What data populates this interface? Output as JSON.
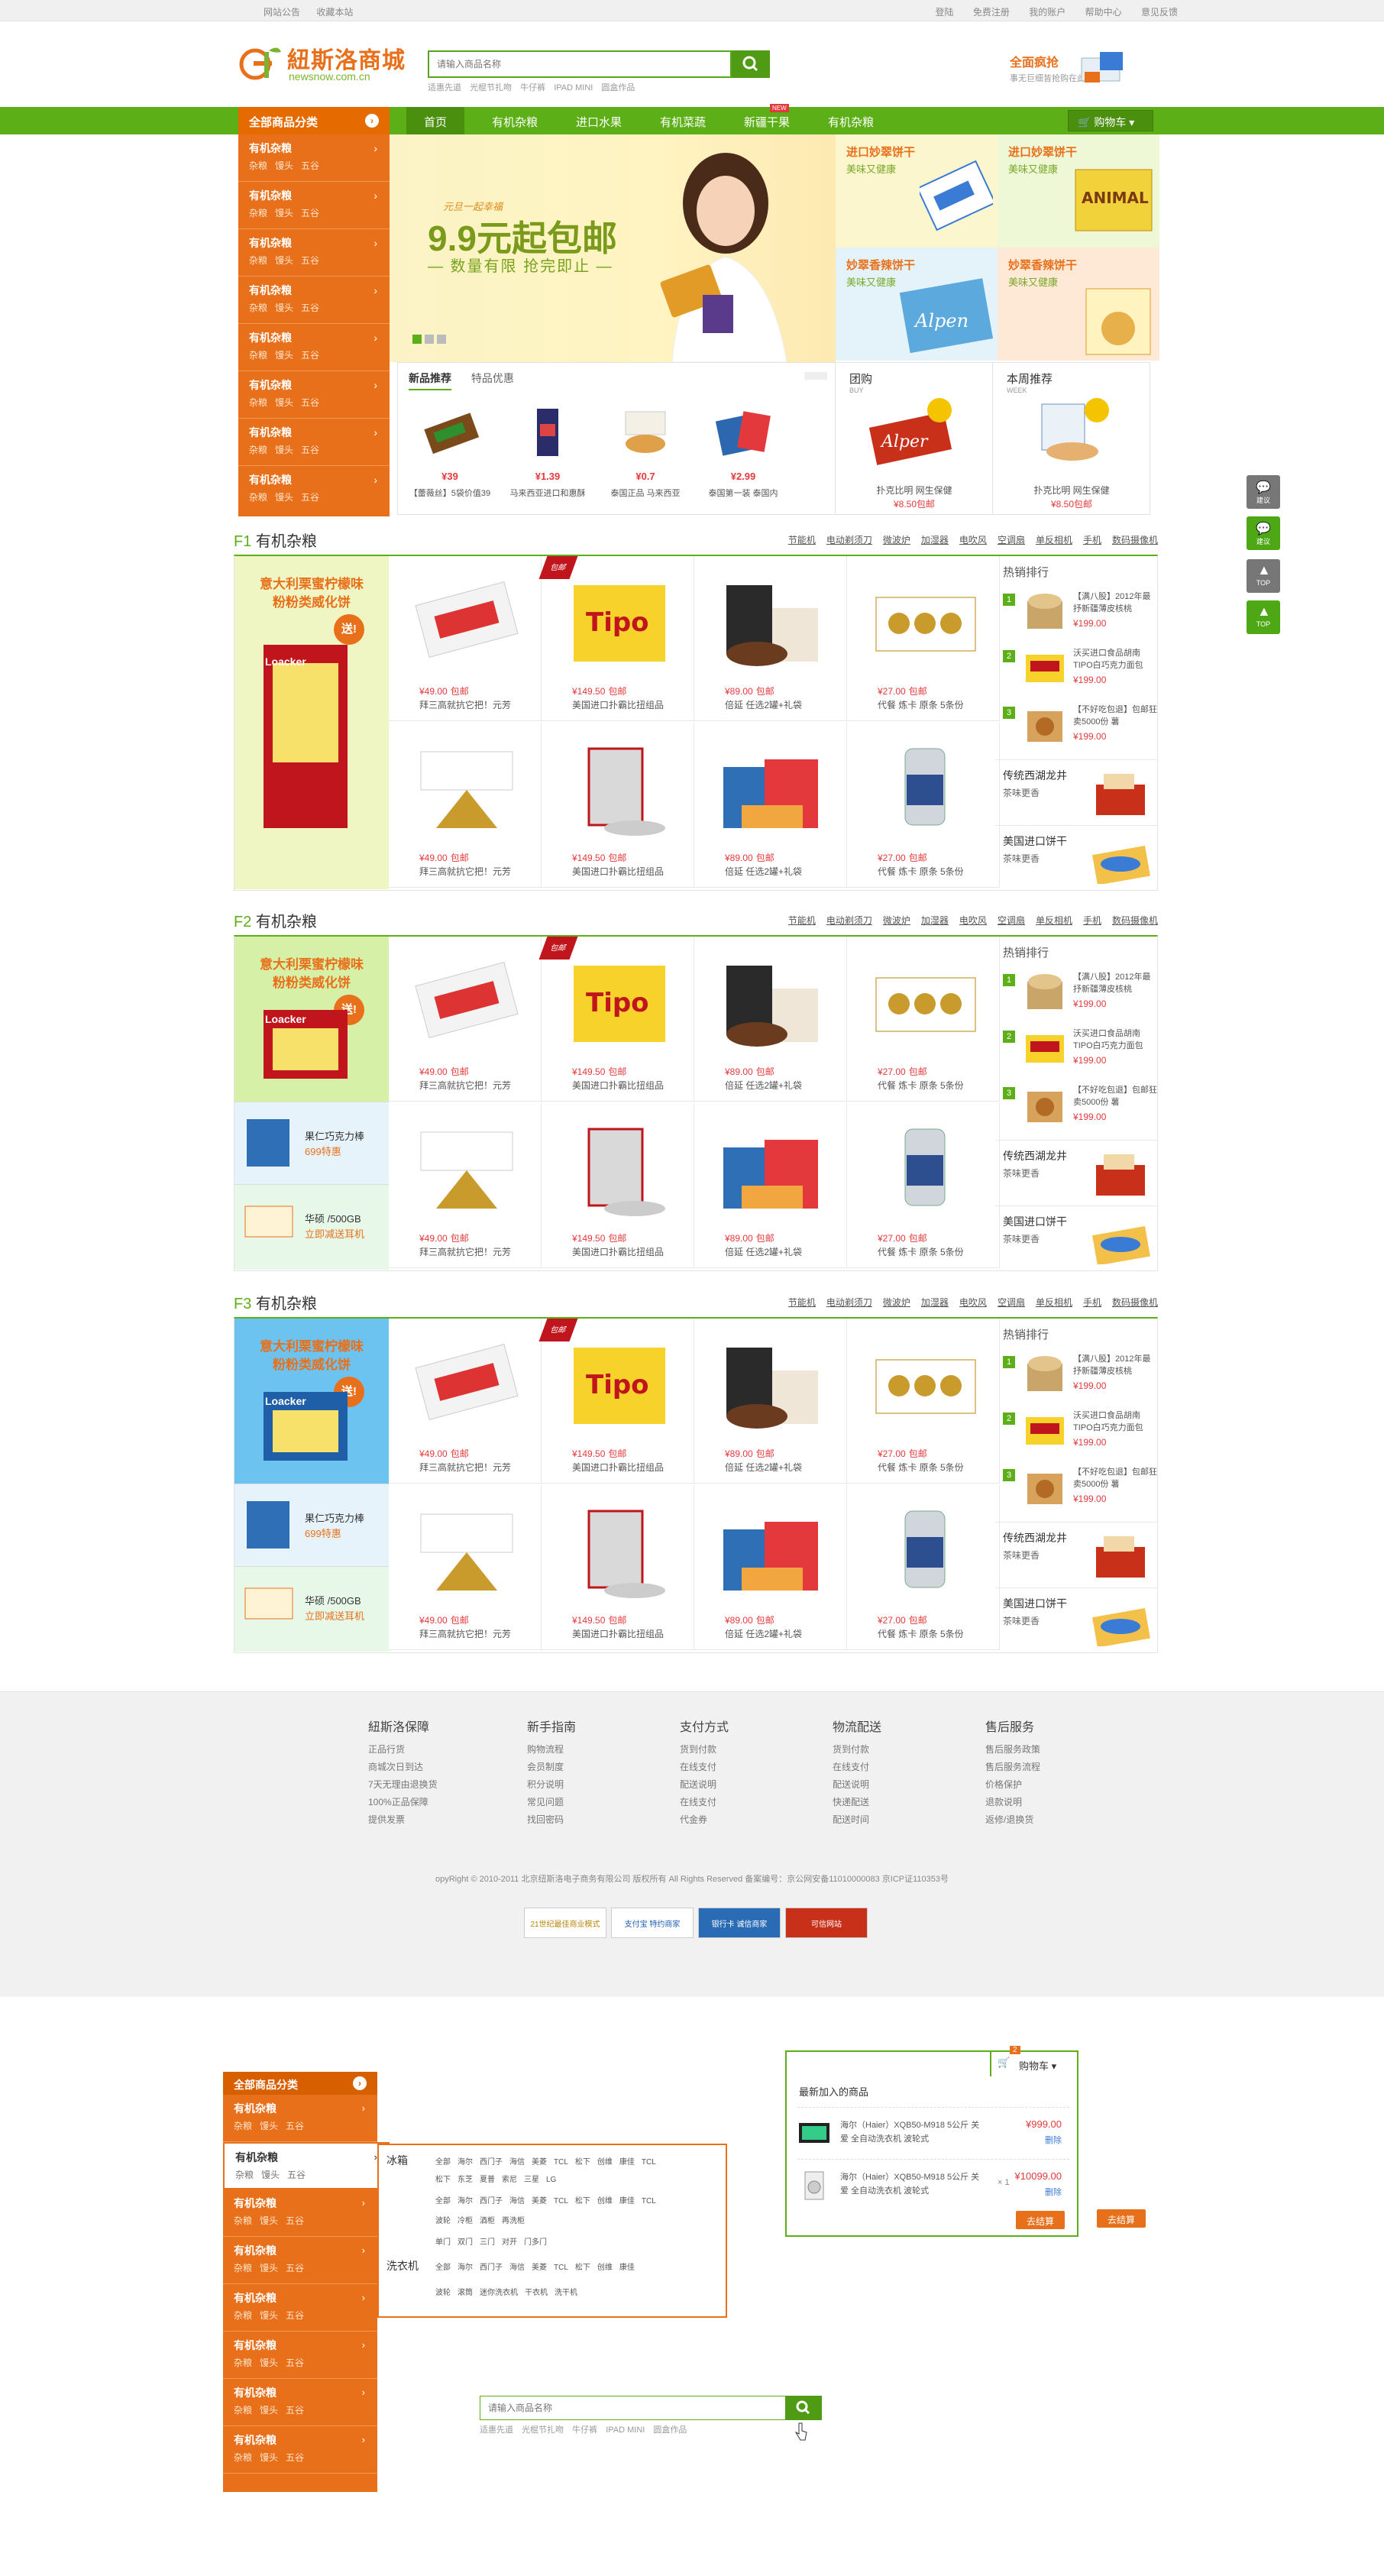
{
  "topbar": {
    "left": [
      "网站公告",
      "收藏本站"
    ],
    "right": [
      "登陆",
      "免费注册",
      "我的账户",
      "帮助中心",
      "意见反馈"
    ]
  },
  "logo": {
    "cn": "紐斯洛商城",
    "en": "newsnow.com.cn"
  },
  "search": {
    "placeholder": "请输入商品名称",
    "hot": [
      "适惠先道",
      "光棍节扎吻",
      "牛仔裤",
      "IPAD MINI",
      "圆盒作品"
    ]
  },
  "header_promo": {
    "title": "全面疯抢",
    "sub": "事无巨细皆抢购在此"
  },
  "nav": {
    "all_categories": "全部商品分类",
    "items": [
      "首页",
      "有机杂粮",
      "进口水果",
      "有机菜蔬",
      "新疆干果",
      "有机杂粮"
    ],
    "new_badge": "NEW",
    "cart": "购物车"
  },
  "categories": [
    {
      "title": "有机杂粮",
      "subs": [
        "杂粮",
        "馒头",
        "五谷"
      ]
    },
    {
      "title": "有机杂粮",
      "subs": [
        "杂粮",
        "馒头",
        "五谷"
      ]
    },
    {
      "title": "有机杂粮",
      "subs": [
        "杂粮",
        "馒头",
        "五谷"
      ]
    },
    {
      "title": "有机杂粮",
      "subs": [
        "杂粮",
        "馒头",
        "五谷"
      ]
    },
    {
      "title": "有机杂粮",
      "subs": [
        "杂粮",
        "馒头",
        "五谷"
      ]
    },
    {
      "title": "有机杂粮",
      "subs": [
        "杂粮",
        "馒头",
        "五谷"
      ]
    },
    {
      "title": "有机杂粮",
      "subs": [
        "杂粮",
        "馒头",
        "五谷"
      ]
    },
    {
      "title": "有机杂粮",
      "subs": [
        "杂粮",
        "馒头",
        "五谷"
      ]
    }
  ],
  "banner": {
    "small": "元旦一起幸福",
    "big": "9.9元起包邮",
    "sub": "— 数量有限 抢完即止 —"
  },
  "side_promos": [
    {
      "t1": "进口妙翠饼干",
      "t2": "美味又健康"
    },
    {
      "t1": "进口妙翠饼干",
      "t2": "美味又健康"
    },
    {
      "t1": "妙翠香辣饼干",
      "t2": "美味又健康"
    },
    {
      "t1": "妙翠香辣饼干",
      "t2": "美味又健康"
    }
  ],
  "new_tabs": [
    "新品推荐",
    "特品优惠"
  ],
  "new_products": [
    {
      "price": "¥39",
      "name": "【蕾薇丝】5袋价值39"
    },
    {
      "price": "¥1.39",
      "name": "马来西亚进口和惠酥"
    },
    {
      "price": "¥0.7",
      "name": "泰国正品 马来西亚"
    },
    {
      "price": "¥2.99",
      "name": "泰国第一装 泰国内"
    }
  ],
  "group_box": {
    "title": "团购",
    "title_en": "BUY",
    "name": "扑克比明 网生保健",
    "price": "¥8.50包邮"
  },
  "week_box": {
    "title": "本周推荐",
    "title_en": "WEEK",
    "name": "扑克比明 网生保健",
    "price": "¥8.50包邮"
  },
  "floor_links": [
    "节能机",
    "电动剃须刀",
    "微波炉",
    "加湿器",
    "电吹风",
    "空调扇",
    "单反相机",
    "手机",
    "数码摄像机"
  ],
  "floors": [
    {
      "num": "F1",
      "title": "有机杂粮"
    },
    {
      "num": "F2",
      "title": "有机杂粮"
    },
    {
      "num": "F3",
      "title": "有机杂粮"
    }
  ],
  "floor_ad": {
    "line1": "意大利栗蜜柠檬味",
    "line2": "粉粉类威化饼",
    "tag": "送!",
    "brand": "Loacker"
  },
  "floor_small_ads": [
    {
      "t1": "果仁巧克力棒",
      "t2": "699特惠"
    },
    {
      "t1": "华硕 /500GB",
      "t2": "立即减送耳机"
    }
  ],
  "floor_products": [
    {
      "price": "¥49.00",
      "tag": "包邮",
      "name": "拜三高就抗它把！元芳"
    },
    {
      "price": "¥149.50",
      "tag": "包邮",
      "name": "美国进口扑霸比扭组品"
    },
    {
      "price": "¥89.00",
      "tag": "包邮",
      "name": "倍延 任选2罐+礼袋"
    },
    {
      "price": "¥27.00",
      "tag": "包邮",
      "name": "代餐 炼卡 原条 5条份"
    },
    {
      "price": "¥49.00",
      "tag": "包邮",
      "name": "拜三高就抗它把！元芳"
    },
    {
      "price": "¥149.50",
      "tag": "包邮",
      "name": "美国进口扑霸比扭组品"
    },
    {
      "price": "¥89.00",
      "tag": "包邮",
      "name": "倍延 任选2罐+礼袋"
    },
    {
      "price": "¥27.00",
      "tag": "包邮",
      "name": "代餐 炼卡 原条 5条份"
    }
  ],
  "hot_badge": "包邮",
  "rank": {
    "title": "热销排行",
    "items": [
      {
        "n": "1",
        "text": "【满八股】2012年最抒新疆薄皮核桃",
        "price": "¥199.00"
      },
      {
        "n": "2",
        "text": "沃买进口食品胡南TIPO白巧克力面包",
        "price": "¥199.00"
      },
      {
        "n": "3",
        "text": "【不好吃包退】包邮狂卖5000份 薯",
        "price": "¥199.00"
      }
    ]
  },
  "right_promos": [
    {
      "t1": "传统西湖龙井",
      "t2": "茶味",
      "t3": "更香"
    },
    {
      "t1": "美国进口饼干",
      "t2": "茶味",
      "t3": "更香"
    }
  ],
  "footer": {
    "cols": [
      {
        "h": "紐斯洛保障",
        "items": [
          "正品行货",
          "商城次日到达",
          "7天无理由退换货",
          "100%正品保障",
          "提供发票"
        ]
      },
      {
        "h": "新手指南",
        "items": [
          "购物流程",
          "会员制度",
          "积分说明",
          "常见问题",
          "找回密码"
        ]
      },
      {
        "h": "支付方式",
        "items": [
          "货到付款",
          "在线支付",
          "配送说明",
          "在线支付",
          "代金券"
        ]
      },
      {
        "h": "物流配送",
        "items": [
          "货到付款",
          "在线支付",
          "配送说明",
          "快递配送",
          "配送时间"
        ]
      },
      {
        "h": "售后服务",
        "items": [
          "售后服务政策",
          "售后服务流程",
          "价格保护",
          "退款说明",
          "返修/退换货"
        ]
      }
    ],
    "copyright": "opyRight © 2010-2011 北京纽斯洛电子商务有限公司 版权所有 All Rights Reserved 备案编号：京公网安备11010000083 京ICP证110353号",
    "badges": [
      "21世纪最佳商业模式",
      "支付宝 特约商家",
      "银行卡 诚信商家",
      "可信网站"
    ]
  },
  "side_buttons": [
    "建议",
    "建议",
    "TOP",
    "TOP"
  ],
  "flyout": {
    "rows": [
      {
        "label": "冰箱",
        "items": [
          "全部",
          "海尔",
          "西门子",
          "海信",
          "美菱",
          "TCL",
          "松下",
          "创维",
          "康佳",
          "TCL"
        ]
      },
      {
        "label": "",
        "items": [
          "松下",
          "东芝",
          "夏普",
          "索尼",
          "三星",
          "LG"
        ]
      },
      {
        "label": "",
        "items": [
          "全部",
          "海尔",
          "西门子",
          "海信",
          "美菱",
          "TCL",
          "松下",
          "创维",
          "康佳",
          "TCL"
        ]
      },
      {
        "label": "",
        "items": [
          "波轮",
          "冷柜",
          "酒柜",
          "再洗柜"
        ]
      },
      {
        "label": "",
        "items": [
          "单门",
          "双门",
          "三门",
          "对开",
          "门多门"
        ]
      },
      {
        "label": "洗衣机",
        "items": [
          "全部",
          "海尔",
          "西门子",
          "海信",
          "美菱",
          "TCL",
          "松下",
          "创维",
          "康佳"
        ]
      },
      {
        "label": "",
        "items": [
          "波轮",
          "滚筒",
          "迷你洗衣机",
          "干衣机",
          "洗干机"
        ]
      }
    ]
  },
  "cart_popup": {
    "header": "购物车",
    "count": "2",
    "title": "最新加入的商品",
    "items": [
      {
        "name": "海尔（Haier）XQB50-M918 5公斤 关爱 全自动洗衣机 波轮式",
        "qty": "",
        "price": "¥999.00",
        "del": "删除"
      },
      {
        "name": "海尔（Haier）XQB50-M918 5公斤 关爱 全自动洗衣机 波轮式",
        "qty": "× 1",
        "price": "¥10099.00",
        "del": "删除"
      }
    ],
    "checkout": "去结算",
    "checkout2": "去结算"
  }
}
